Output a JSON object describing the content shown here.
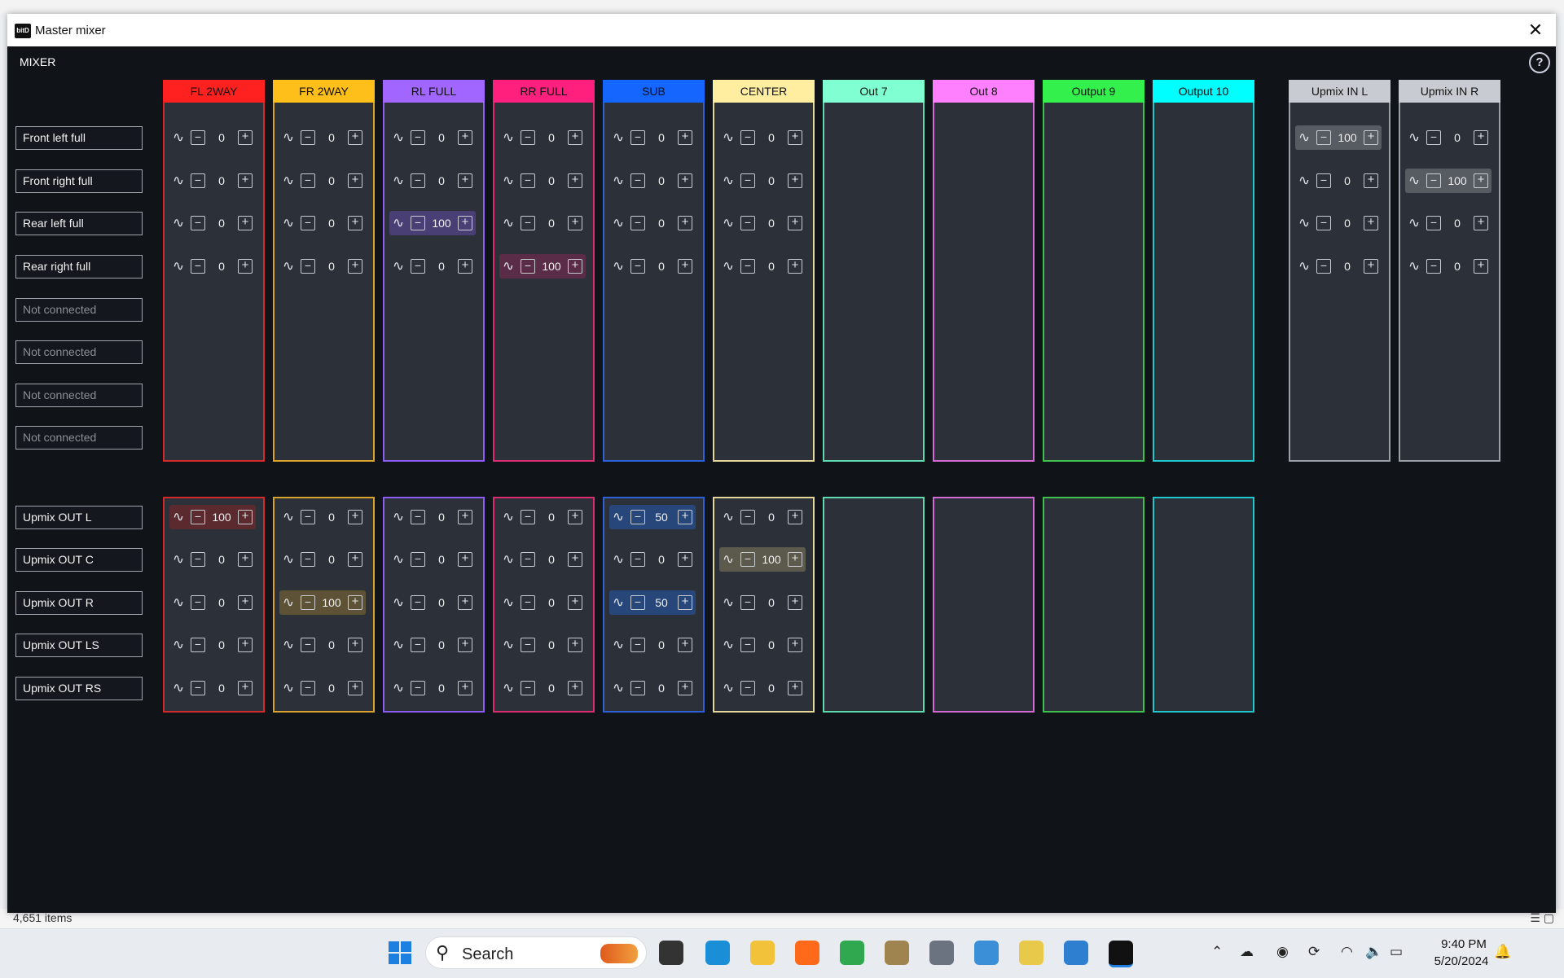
{
  "window": {
    "title": "Master mixer",
    "logo_text": "bitD",
    "close_glyph": "✕"
  },
  "mixer": {
    "label": "MIXER",
    "help_glyph": "?"
  },
  "inputs_top": [
    "Front left full",
    "Front right full",
    "Rear left full",
    "Rear right full",
    "Not connected",
    "Not connected",
    "Not connected",
    "Not connected"
  ],
  "inputs_bottom": [
    "Upmix OUT L",
    "Upmix OUT C",
    "Upmix OUT R",
    "Upmix OUT LS",
    "Upmix OUT RS"
  ],
  "outputs": [
    {
      "name": "FL 2WAY",
      "header_bg": "#ff2020",
      "header_text": "#111111",
      "border": "#d42a2a",
      "active_bg": "#5a2a2e"
    },
    {
      "name": "FR 2WAY",
      "header_bg": "#ffbf1a",
      "header_text": "#111111",
      "border": "#d9a22a",
      "active_bg": "#5e5236"
    },
    {
      "name": "RL FULL",
      "header_bg": "#a066ff",
      "header_text": "#111111",
      "border": "#8d5cf2",
      "active_bg": "#4a3f74"
    },
    {
      "name": "RR FULL",
      "header_bg": "#ff1f7d",
      "header_text": "#111111",
      "border": "#dc2b70",
      "active_bg": "#5a2c48"
    },
    {
      "name": "SUB",
      "header_bg": "#1565ff",
      "header_text": "#111111",
      "border": "#2d62d6",
      "active_bg": "#27467a"
    },
    {
      "name": "CENTER",
      "header_bg": "#ffeea0",
      "header_text": "#111111",
      "border": "#e5d79a",
      "active_bg": "#5c5a4c"
    },
    {
      "name": "Out 7",
      "header_bg": "#80ffd2",
      "header_text": "#111111",
      "border": "#5fd9b0"
    },
    {
      "name": "Out 8",
      "header_bg": "#ff80ff",
      "header_text": "#111111",
      "border": "#d46ad4"
    },
    {
      "name": "Output 9",
      "header_bg": "#33f04d",
      "header_text": "#111111",
      "border": "#3ec24d"
    },
    {
      "name": "Output 10",
      "header_bg": "#00ffff",
      "header_text": "#111111",
      "border": "#1ec8cc"
    },
    {
      "name": "Upmix IN L",
      "header_bg": "#c8ccd2",
      "header_text": "#111111",
      "border": "#9aa0a8",
      "active_bg": "#575b62"
    },
    {
      "name": "Upmix IN R",
      "header_bg": "#c8ccd2",
      "header_text": "#111111",
      "border": "#9aa0a8",
      "active_bg": "#575b62"
    }
  ],
  "matrix_top": [
    [
      0,
      0,
      0,
      0,
      0,
      0,
      null,
      null,
      null,
      null,
      100,
      0
    ],
    [
      0,
      0,
      0,
      0,
      0,
      0,
      null,
      null,
      null,
      null,
      0,
      100
    ],
    [
      0,
      0,
      100,
      0,
      0,
      0,
      null,
      null,
      null,
      null,
      0,
      0
    ],
    [
      0,
      0,
      0,
      100,
      0,
      0,
      null,
      null,
      null,
      null,
      0,
      0
    ]
  ],
  "matrix_bottom": [
    [
      100,
      0,
      0,
      0,
      50,
      0
    ],
    [
      0,
      0,
      0,
      0,
      0,
      100
    ],
    [
      0,
      100,
      0,
      0,
      50,
      0
    ],
    [
      0,
      0,
      0,
      0,
      0,
      0
    ],
    [
      0,
      0,
      0,
      0,
      0,
      0
    ]
  ],
  "glyphs": {
    "wave": "∿",
    "minus": "−",
    "plus": "+"
  },
  "background": {
    "status_text": "4,651 items"
  },
  "taskbar": {
    "search_placeholder": "Search",
    "search_glyph": "⚲",
    "time": "9:40 PM",
    "date": "5/20/2024",
    "apps": [
      {
        "name": "task-view-icon",
        "color": "#333333"
      },
      {
        "name": "edge-icon",
        "color": "#1a8fd8"
      },
      {
        "name": "file-explorer-icon",
        "color": "#f2c23a"
      },
      {
        "name": "firefox-icon",
        "color": "#ff6a1a"
      },
      {
        "name": "chrome-icon",
        "color": "#2fa84f"
      },
      {
        "name": "app-icon",
        "color": "#a08450"
      },
      {
        "name": "settings-gear-icon",
        "color": "#6b7280"
      },
      {
        "name": "control-panel-icon",
        "color": "#3b8fd6"
      },
      {
        "name": "notes-icon",
        "color": "#e8c94a"
      },
      {
        "name": "photos-icon",
        "color": "#2f7fd1"
      },
      {
        "name": "bitd-icon",
        "color": "#111111"
      }
    ],
    "tray": [
      {
        "name": "chevron-up-icon",
        "glyph": "⌃"
      },
      {
        "name": "onedrive-icon",
        "glyph": "☁"
      },
      {
        "name": "zoom-icon",
        "glyph": "◉"
      },
      {
        "name": "sync-icon",
        "glyph": "⟳"
      },
      {
        "name": "wifi-icon",
        "glyph": "◠"
      },
      {
        "name": "speaker-icon",
        "glyph": "🔈"
      },
      {
        "name": "battery-icon",
        "glyph": "▭"
      },
      {
        "name": "notification-icon",
        "glyph": "🔔"
      }
    ]
  }
}
